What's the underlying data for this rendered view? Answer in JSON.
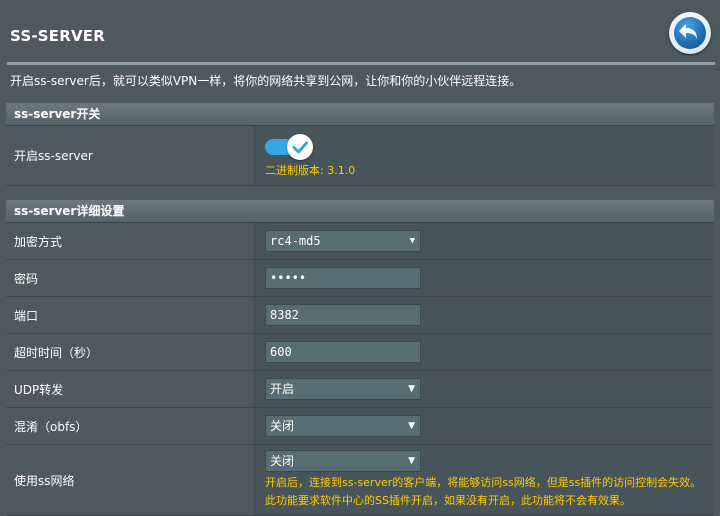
{
  "header": {
    "title": "SS-SERVER",
    "description": "开启ss-server后，就可以类似VPN一样，将你的网络共享到公网，让你和你的小伙伴远程连接。"
  },
  "switch_section": {
    "title": "ss-server开关",
    "enable_label": "开启ss-server",
    "enabled": true,
    "version_text": "二进制版本: 3.1.0"
  },
  "detail_section": {
    "title": "ss-server详细设置",
    "encryption": {
      "label": "加密方式",
      "value": "rc4-md5"
    },
    "password": {
      "label": "密码",
      "value": "•••••"
    },
    "port": {
      "label": "端口",
      "value": "8382"
    },
    "timeout": {
      "label": "超时时间（秒）",
      "value": "600"
    },
    "udp": {
      "label": "UDP转发",
      "value": "开启"
    },
    "obfs": {
      "label": "混淆（obfs）",
      "value": "关闭"
    },
    "use_ss": {
      "label": "使用ss网络",
      "value": "关闭",
      "note_line1": "开启后，连接到ss-server的客户端，将能够访问ss网络，但是ss插件的访问控制会失效。",
      "note_line2": "此功能要求软件中心的SS插件开启，如果没有开启，此功能将不会有效果。"
    }
  },
  "colors": {
    "background": "#4d595d",
    "value_cell": "#475459",
    "accent_blue": "#35a7e3",
    "note_yellow": "#ffcc00"
  },
  "icons": {
    "back": "back-arrow-icon",
    "toggle_check": "check-icon",
    "dropdown": "chevron-down-icon"
  }
}
